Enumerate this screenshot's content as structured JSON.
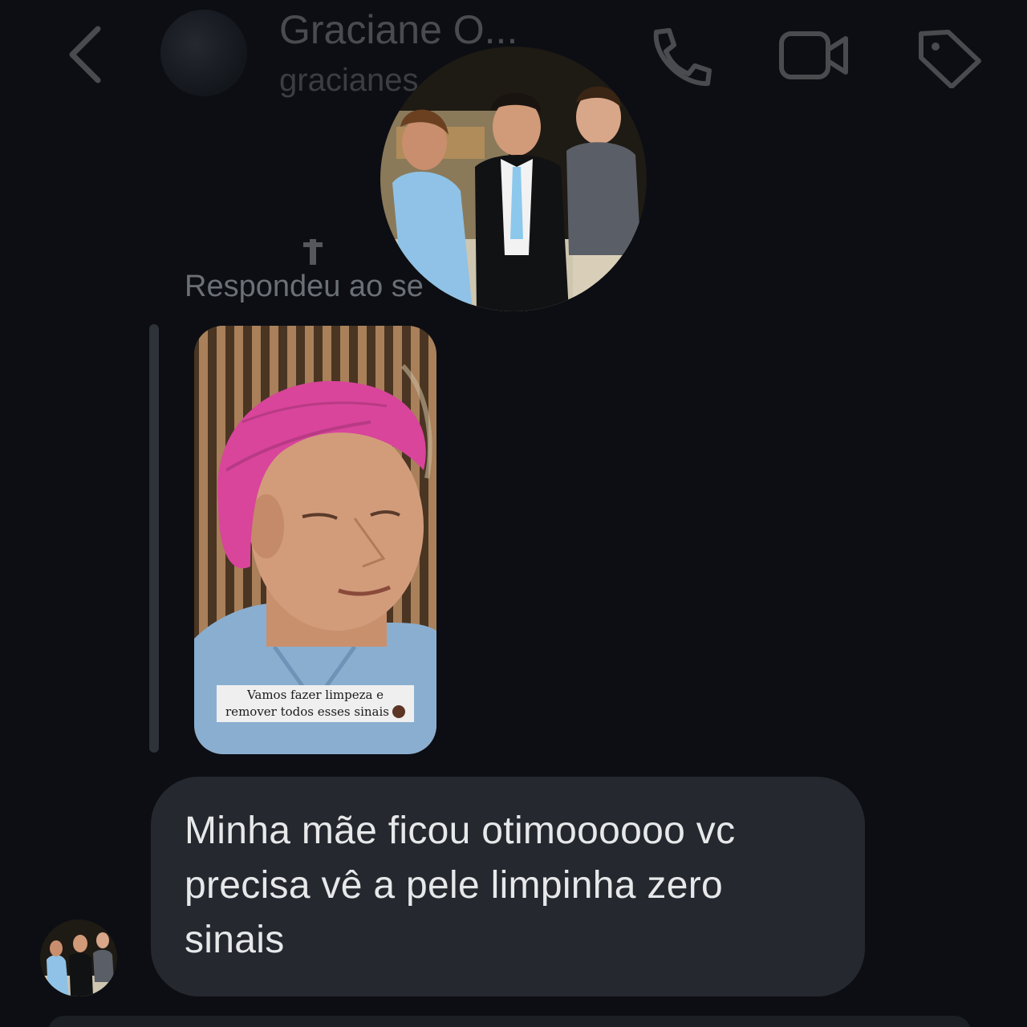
{
  "header": {
    "name": "Graciane O...",
    "handle": "gracianes",
    "back_icon": "chevron-left-icon",
    "call_icon": "phone-icon",
    "video_icon": "video-camera-icon",
    "tag_icon": "tag-icon"
  },
  "story_reply": {
    "label": "Respondeu ao se",
    "story_caption_line1": "Vamos fazer limpeza e",
    "story_caption_line2": "remover todos esses sinais"
  },
  "message": {
    "line1": "Minha mãe ficou otimoooooo vc",
    "line2": "precisa vê a pele limpinha zero",
    "line3": "sinais"
  },
  "colors": {
    "background": "#0c0e13",
    "bubble": "#25282e",
    "text": "#e7e8ea",
    "muted": "#6b6f76"
  }
}
